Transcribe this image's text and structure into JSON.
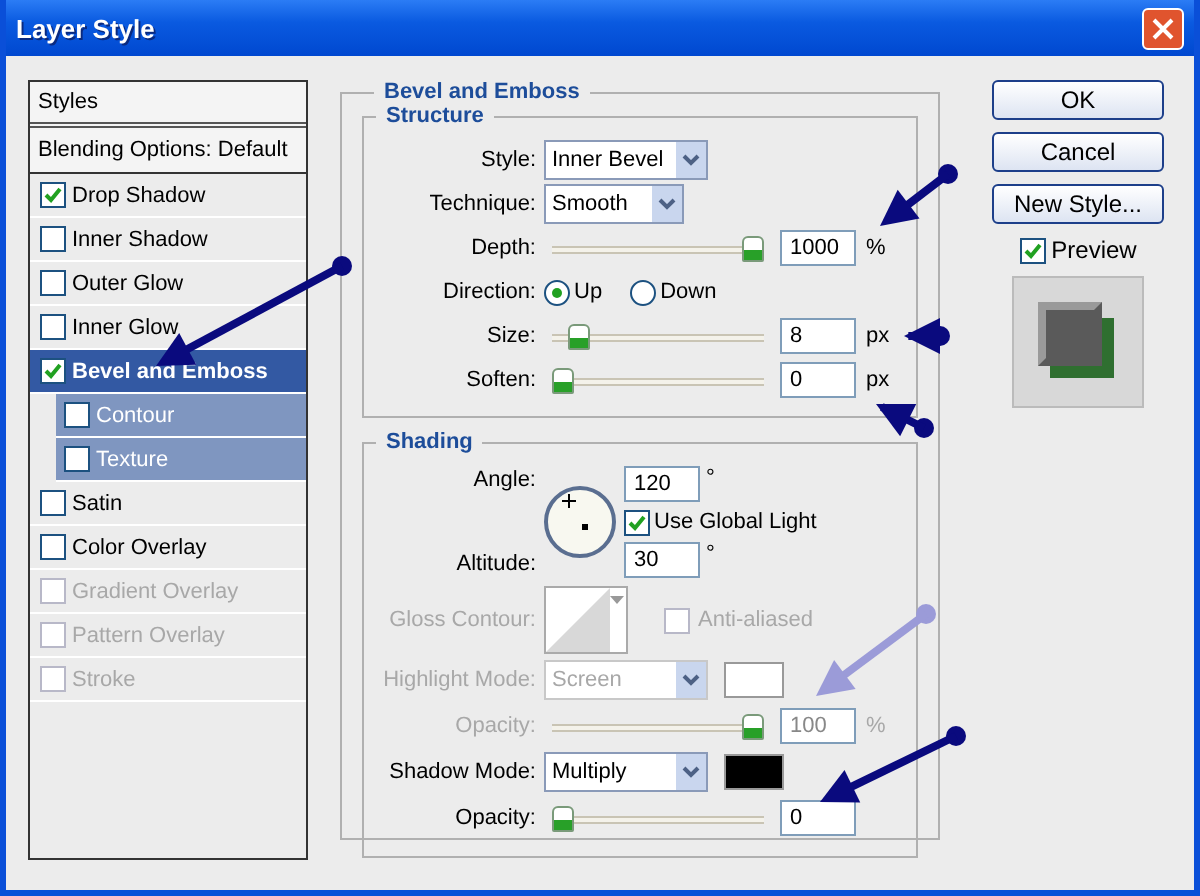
{
  "window": {
    "title": "Layer Style"
  },
  "sidebar": {
    "items": [
      {
        "kind": "header",
        "label": "Styles"
      },
      {
        "kind": "header",
        "label": "Blending Options: Default"
      },
      {
        "kind": "check",
        "label": "Drop Shadow",
        "checked": true,
        "selected": false,
        "disabled": false
      },
      {
        "kind": "check",
        "label": "Inner Shadow",
        "checked": false,
        "selected": false,
        "disabled": false
      },
      {
        "kind": "check",
        "label": "Outer Glow",
        "checked": false,
        "selected": false,
        "disabled": false
      },
      {
        "kind": "check",
        "label": "Inner Glow",
        "checked": false,
        "selected": false,
        "disabled": false
      },
      {
        "kind": "check",
        "label": "Bevel and Emboss",
        "checked": true,
        "selected": true,
        "disabled": false,
        "children": [
          {
            "kind": "check",
            "label": "Contour",
            "checked": false,
            "selected": false,
            "disabled": false
          },
          {
            "kind": "check",
            "label": "Texture",
            "checked": false,
            "selected": false,
            "disabled": false
          }
        ]
      },
      {
        "kind": "check",
        "label": "Satin",
        "checked": false,
        "selected": false,
        "disabled": false
      },
      {
        "kind": "check",
        "label": "Color Overlay",
        "checked": false,
        "selected": false,
        "disabled": false
      },
      {
        "kind": "check",
        "label": "Gradient Overlay",
        "checked": false,
        "selected": false,
        "disabled": true
      },
      {
        "kind": "check",
        "label": "Pattern Overlay",
        "checked": false,
        "selected": false,
        "disabled": true
      },
      {
        "kind": "check",
        "label": "Stroke",
        "checked": false,
        "selected": false,
        "disabled": true
      }
    ]
  },
  "panel": {
    "title": "Bevel and Emboss",
    "structure": {
      "title": "Structure",
      "rows": [
        {
          "kind": "select",
          "label": "Style:",
          "value": "Inner Bevel"
        },
        {
          "kind": "select",
          "label": "Technique:",
          "value": "Smooth"
        },
        {
          "kind": "slider",
          "label": "Depth:",
          "level": 1,
          "value": "1000",
          "unit": "%"
        },
        {
          "kind": "radio",
          "label": "Direction:",
          "options": [
            {
              "label": "Up",
              "selected": true
            },
            {
              "label": "Down",
              "selected": false
            }
          ]
        },
        {
          "kind": "slider",
          "label": "Size:",
          "level": 0.08,
          "value": "8",
          "unit": "px"
        },
        {
          "kind": "slider",
          "label": "Soften:",
          "level": 0,
          "value": "0",
          "unit": "px"
        }
      ]
    },
    "shading": {
      "title": "Shading",
      "angle": {
        "label": "Angle:",
        "value": "120",
        "unit": "°"
      },
      "global_light": {
        "label": "Use Global Light",
        "checked": true
      },
      "altitude": {
        "label": "Altitude:",
        "value": "30",
        "unit": "°"
      },
      "rows": [
        {
          "kind": "contour",
          "label": "Gloss Contour:",
          "option": {
            "label": "Anti-aliased",
            "checked": false
          },
          "disabled": true
        },
        {
          "kind": "select",
          "label": "Highlight Mode:",
          "value": "Screen",
          "color": "#ffffff",
          "disabled": true
        },
        {
          "kind": "slider",
          "label": "Opacity:",
          "level": 1,
          "value": "100",
          "unit": "%",
          "disabled": true
        },
        {
          "kind": "select",
          "label": "Shadow Mode:",
          "value": "Multiply",
          "color": "#000000",
          "disabled": false
        },
        {
          "kind": "slider",
          "label": "Opacity:",
          "level": 0,
          "value": "0",
          "disabled": false
        }
      ]
    }
  },
  "buttons": [
    "OK",
    "Cancel",
    "New Style..."
  ],
  "preview": {
    "label": "Preview",
    "checked": true
  }
}
